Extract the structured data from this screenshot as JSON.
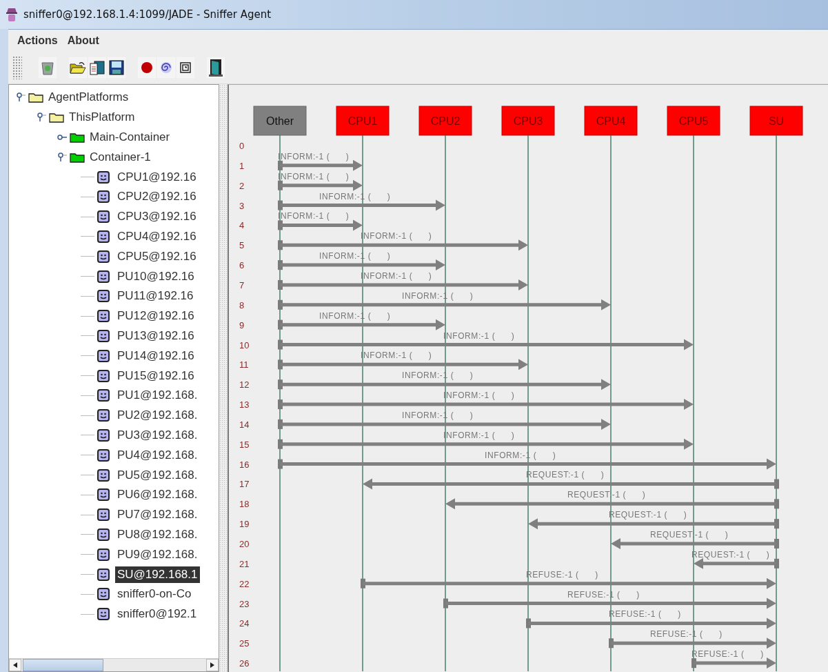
{
  "window": {
    "title": "sniffer0@192.168.1.4:1099/JADE - Sniffer Agent"
  },
  "menu": [
    "Actions",
    "About"
  ],
  "tree": [
    {
      "label": "AgentPlatforms",
      "kind": "folder",
      "expanded": true,
      "selected": false,
      "children": [
        {
          "label": "ThisPlatform",
          "kind": "folder",
          "expanded": true,
          "selected": false,
          "children": [
            {
              "label": "Main-Container",
              "kind": "container",
              "expanded": false,
              "selected": false
            },
            {
              "label": "Container-1",
              "kind": "container",
              "expanded": true,
              "selected": false,
              "children": [
                {
                  "label": "CPU1@192.16",
                  "kind": "agent",
                  "selected": false
                },
                {
                  "label": "CPU2@192.16",
                  "kind": "agent",
                  "selected": false
                },
                {
                  "label": "CPU3@192.16",
                  "kind": "agent",
                  "selected": false
                },
                {
                  "label": "CPU4@192.16",
                  "kind": "agent",
                  "selected": false
                },
                {
                  "label": "CPU5@192.16",
                  "kind": "agent",
                  "selected": false
                },
                {
                  "label": "PU10@192.16",
                  "kind": "agent",
                  "selected": false
                },
                {
                  "label": "PU11@192.16",
                  "kind": "agent",
                  "selected": false
                },
                {
                  "label": "PU12@192.16",
                  "kind": "agent",
                  "selected": false
                },
                {
                  "label": "PU13@192.16",
                  "kind": "agent",
                  "selected": false
                },
                {
                  "label": "PU14@192.16",
                  "kind": "agent",
                  "selected": false
                },
                {
                  "label": "PU15@192.16",
                  "kind": "agent",
                  "selected": false
                },
                {
                  "label": "PU1@192.168.",
                  "kind": "agent",
                  "selected": false
                },
                {
                  "label": "PU2@192.168.",
                  "kind": "agent",
                  "selected": false
                },
                {
                  "label": "PU3@192.168.",
                  "kind": "agent",
                  "selected": false
                },
                {
                  "label": "PU4@192.168.",
                  "kind": "agent",
                  "selected": false
                },
                {
                  "label": "PU5@192.168.",
                  "kind": "agent",
                  "selected": false
                },
                {
                  "label": "PU6@192.168.",
                  "kind": "agent",
                  "selected": false
                },
                {
                  "label": "PU7@192.168.",
                  "kind": "agent",
                  "selected": false
                },
                {
                  "label": "PU8@192.168.",
                  "kind": "agent",
                  "selected": false
                },
                {
                  "label": "PU9@192.168.",
                  "kind": "agent",
                  "selected": false
                },
                {
                  "label": "SU@192.168.1",
                  "kind": "agent",
                  "selected": true
                },
                {
                  "label": "sniffer0-on-Co",
                  "kind": "agent",
                  "selected": false
                },
                {
                  "label": "sniffer0@192.1",
                  "kind": "agent",
                  "selected": false
                }
              ]
            }
          ]
        }
      ]
    }
  ],
  "agents": [
    {
      "name": "Other",
      "kind": "other"
    },
    {
      "name": "CPU1",
      "kind": "sniffed"
    },
    {
      "name": "CPU2",
      "kind": "sniffed"
    },
    {
      "name": "CPU3",
      "kind": "sniffed"
    },
    {
      "name": "CPU4",
      "kind": "sniffed"
    },
    {
      "name": "CPU5",
      "kind": "sniffed"
    },
    {
      "name": "SU",
      "kind": "sniffed"
    }
  ],
  "rows": [
    {
      "number": "0"
    },
    {
      "number": "1",
      "message": {
        "label": "INFORM:-1 (      )"
      }
    },
    {
      "number": "2",
      "message": {
        "label": "INFORM:-1 (      )"
      }
    },
    {
      "number": "3",
      "message": {
        "label": "INFORM:-1 (      )"
      }
    },
    {
      "number": "4",
      "message": {
        "label": "INFORM:-1 (      )"
      }
    },
    {
      "number": "5",
      "message": {
        "label": "INFORM:-1 (      )"
      }
    },
    {
      "number": "6",
      "message": {
        "label": "INFORM:-1 (      )"
      }
    },
    {
      "number": "7",
      "message": {
        "label": "INFORM:-1 (      )"
      }
    },
    {
      "number": "8",
      "message": {
        "label": "INFORM:-1 (      )"
      }
    },
    {
      "number": "9",
      "message": {
        "label": "INFORM:-1 (      )"
      }
    },
    {
      "number": "10",
      "message": {
        "label": "INFORM:-1 (      )"
      }
    },
    {
      "number": "11",
      "message": {
        "label": "INFORM:-1 (      )"
      }
    },
    {
      "number": "12",
      "message": {
        "label": "INFORM:-1 (      )"
      }
    },
    {
      "number": "13",
      "message": {
        "label": "INFORM:-1 (      )"
      }
    },
    {
      "number": "14",
      "message": {
        "label": "INFORM:-1 (      )"
      }
    },
    {
      "number": "15",
      "message": {
        "label": "INFORM:-1 (      )"
      }
    },
    {
      "number": "16",
      "message": {
        "label": "INFORM:-1 (      )"
      }
    },
    {
      "number": "17",
      "message": {
        "label": "REQUEST:-1 (      )"
      }
    },
    {
      "number": "18",
      "message": {
        "label": "REQUEST:-1 (      )"
      }
    },
    {
      "number": "19",
      "message": {
        "label": "REQUEST:-1 (      )"
      }
    },
    {
      "number": "20",
      "message": {
        "label": "REQUEST:-1 (      )"
      }
    },
    {
      "number": "21",
      "message": {
        "label": "REQUEST:-1 (      )"
      }
    },
    {
      "number": "22",
      "message": {
        "label": "REFUSE:-1 (      )"
      }
    },
    {
      "number": "23",
      "message": {
        "label": "REFUSE:-1 (      )"
      }
    },
    {
      "number": "24",
      "message": {
        "label": "REFUSE:-1 (      )"
      }
    },
    {
      "number": "25",
      "message": {
        "label": "REFUSE:-1 (      )"
      }
    },
    {
      "number": "26",
      "message": {
        "label": "REFUSE:-1 (      )"
      }
    }
  ]
}
